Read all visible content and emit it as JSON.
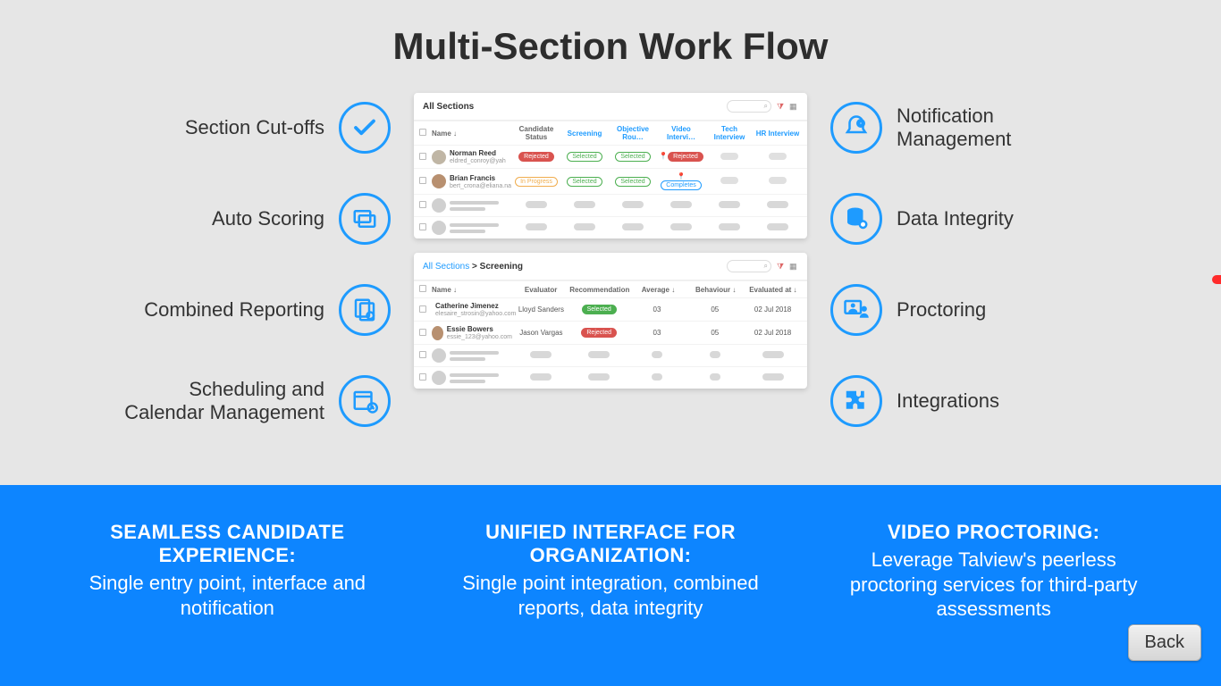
{
  "title": "Multi-Section Work Flow",
  "left_features": [
    {
      "name": "cutoffs",
      "label": "Section Cut-offs"
    },
    {
      "name": "scoring",
      "label": "Auto Scoring"
    },
    {
      "name": "reporting",
      "label": "Combined Reporting"
    },
    {
      "name": "scheduling",
      "label": "Scheduling and Calendar Management"
    }
  ],
  "right_features": [
    {
      "name": "notification",
      "label": "Notification Management"
    },
    {
      "name": "integrity",
      "label": "Data Integrity"
    },
    {
      "name": "proctoring",
      "label": "Proctoring"
    },
    {
      "name": "integrations",
      "label": "Integrations"
    }
  ],
  "panel1": {
    "breadcrumb": "All Sections",
    "columns": [
      "Name ↓",
      "Candidate Status",
      "Screening",
      "Objective Rou…",
      "Video Intervi…",
      "Tech Interview",
      "HR Interview"
    ],
    "rows": [
      {
        "name": "Norman Reed",
        "email": "eldred_conroy@yah",
        "status": "Rejected",
        "c": [
          "Selected",
          "Selected",
          "Rejected",
          "",
          ""
        ]
      },
      {
        "name": "Brian Francis",
        "email": "bert_crona@eliana.na",
        "status": "In Progress",
        "c": [
          "Selected",
          "Selected",
          "Completes",
          "",
          ""
        ]
      }
    ]
  },
  "panel2": {
    "breadcrumb_link": "All Sections",
    "breadcrumb_curr": "Screening",
    "columns": [
      "Name ↓",
      "Evaluator",
      "Recommendation",
      "Average ↓",
      "Behaviour ↓",
      "Evaluated at ↓"
    ],
    "rows": [
      {
        "name": "Catherine Jimenez",
        "email": "elesaire_strosin@yahoo.com",
        "ev": "Lloyd Sanders",
        "rec": "Selected",
        "avg": "03",
        "beh": "05",
        "date": "02 Jul 2018"
      },
      {
        "name": "Essie Bowers",
        "email": "essie_123@yahoo.com",
        "ev": "Jason Vargas",
        "rec": "Rejected",
        "avg": "03",
        "beh": "05",
        "date": "02 Jul 2018"
      }
    ]
  },
  "footer": [
    {
      "h": "SEAMLESS CANDIDATE EXPERIENCE:",
      "p": "Single entry point, interface and notification"
    },
    {
      "h": "UNIFIED INTERFACE FOR ORGANIZATION:",
      "p": "Single point integration, combined reports, data integrity"
    },
    {
      "h": "VIDEO PROCTORING:",
      "p": "Leverage Talview's peerless proctoring services for third-party assessments"
    }
  ],
  "back_label": "Back"
}
